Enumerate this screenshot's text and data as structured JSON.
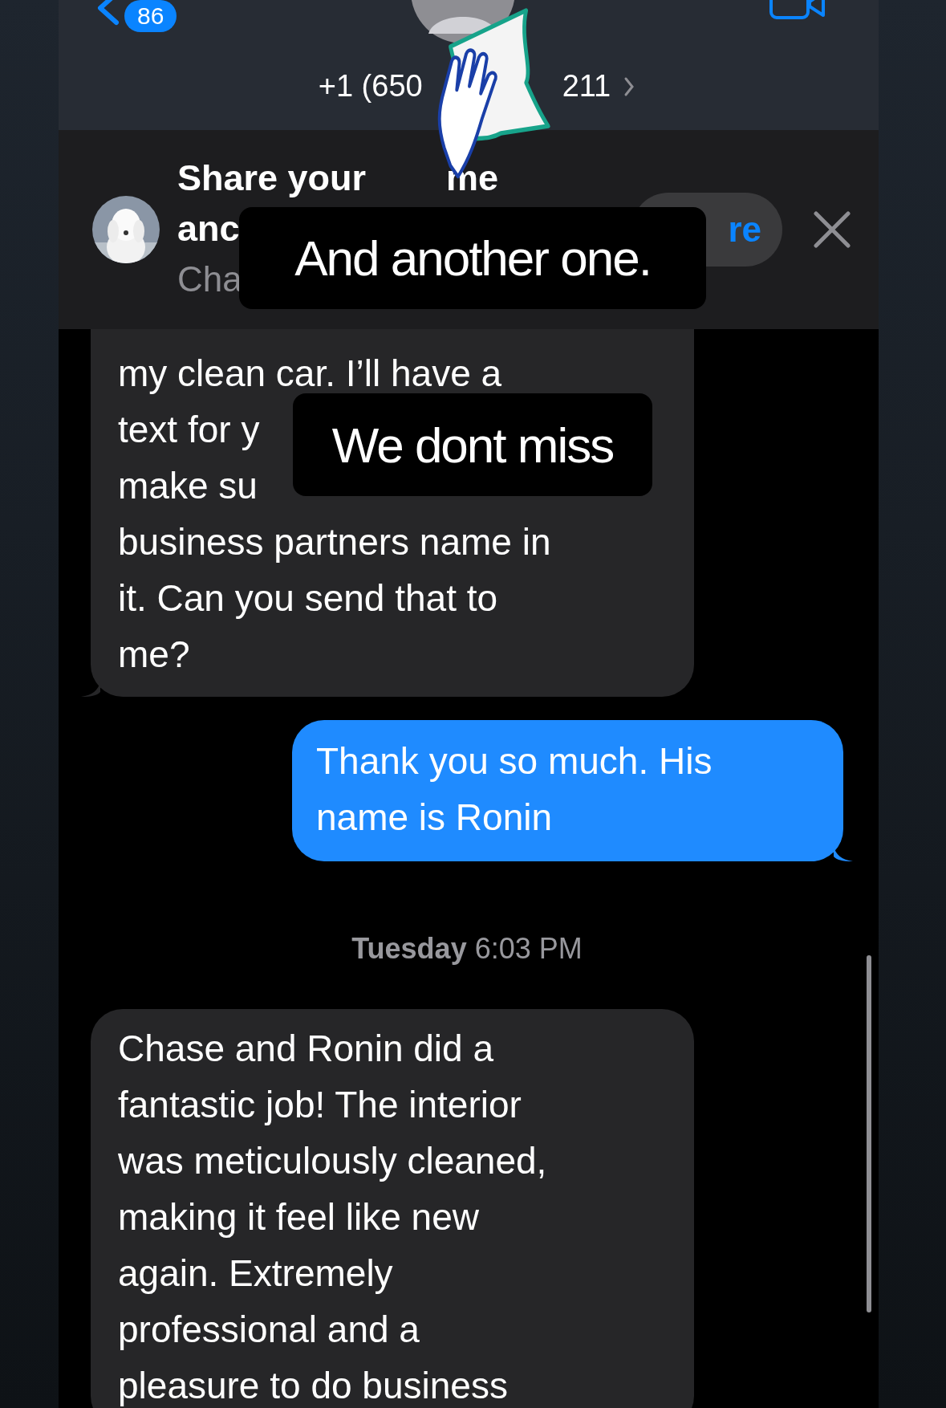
{
  "header": {
    "back_badge": "86",
    "contact_number_parts": [
      "+1 (650",
      "211"
    ]
  },
  "share_banner": {
    "title_parts": [
      "Share your",
      "me"
    ],
    "line_2": "anc",
    "line_3": "Cha",
    "button_label": "re"
  },
  "messages": [
    {
      "kind": "received",
      "lines": [
        "my clean car. I’ll have a",
        "text for y",
        "make su",
        "business partners name in",
        "it. Can you send that to",
        "me?"
      ]
    },
    {
      "kind": "sent",
      "lines": [
        "Thank you so much. His",
        "name is Ronin"
      ]
    },
    {
      "kind": "timestamp",
      "day": "Tuesday",
      "time": "6:03 PM"
    },
    {
      "kind": "received",
      "lines": [
        "Chase and Ronin did a",
        "fantastic job! The interior",
        "was meticulously cleaned,",
        "making it feel like new",
        "again. Extremely",
        "professional and a",
        "pleasure to do business"
      ]
    }
  ],
  "captions": [
    {
      "text": "And another one."
    },
    {
      "text": "We dont miss"
    }
  ]
}
